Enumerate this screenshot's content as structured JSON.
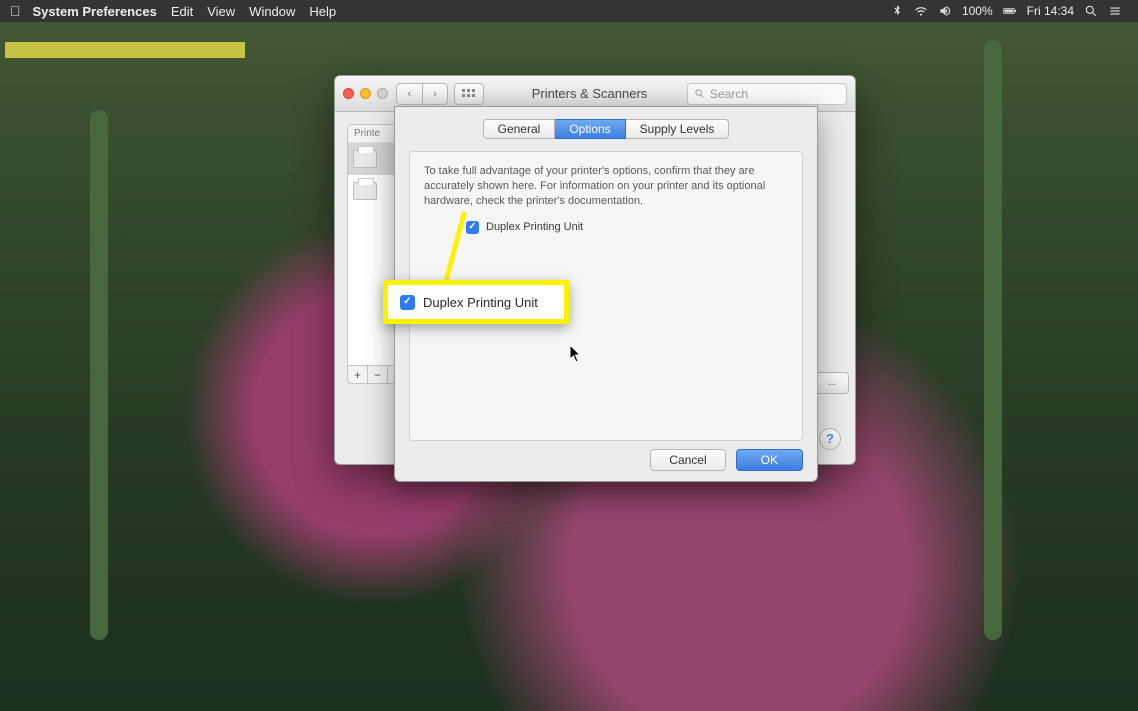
{
  "menubar": {
    "app_name": "System Preferences",
    "items": [
      "Edit",
      "View",
      "Window",
      "Help"
    ],
    "battery_pct": "100%",
    "clock": "Fri 14:34"
  },
  "window": {
    "title": "Printers & Scanners",
    "search_placeholder": "Search",
    "sidebar_header": "Printe",
    "add_label": "+",
    "remove_label": "−",
    "dots_label": "..."
  },
  "sheet": {
    "tabs": {
      "general": "General",
      "options": "Options",
      "supply": "Supply Levels"
    },
    "description": "To take full advantage of your printer's options, confirm that they are accurately shown here. For information on your printer and its optional hardware, check the printer's documentation.",
    "duplex_label": "Duplex Printing Unit",
    "cancel": "Cancel",
    "ok": "OK"
  },
  "callout": {
    "label": "Duplex Printing Unit"
  },
  "help_label": "?"
}
